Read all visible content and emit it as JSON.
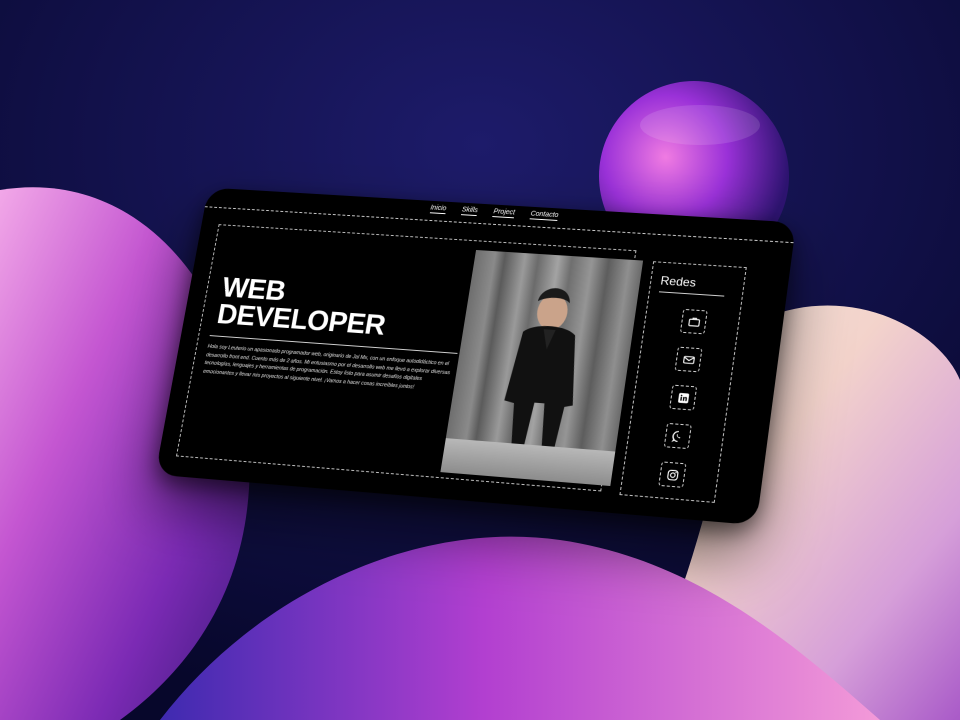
{
  "nav": {
    "items": [
      "Inicio",
      "Skills",
      "Project",
      "Contacto"
    ]
  },
  "hero": {
    "title_line1": "WEB",
    "title_line2": "DEVELOPER",
    "bio": "Hola soy Leuterio un apasionado programador web, originario de Jal Mx, con un enfoque autodidáctico en el desarrollo front end. Cuento más de 2 años. Mi entusiasmo por el desarrollo web me llevó a explorar diversas tecnologías, lenguajes y herramientas de programación. Estoy listo para asumir desafíos digitales emocionantes y llevar mis proyectos al siguiente nivel. ¡Vamos a hacer cosas increíbles juntos!"
  },
  "photo": {
    "alt": "Portrait"
  },
  "social": {
    "title": "Redes",
    "icons": [
      "briefcase-icon",
      "mail-icon",
      "linkedin-icon",
      "whatsapp-icon",
      "instagram-icon"
    ]
  },
  "colors": {
    "card_bg": "#000000",
    "accent_purple": "#9b3fd3",
    "accent_pink": "#d257c8",
    "bg_navy": "#0b0b3a"
  }
}
